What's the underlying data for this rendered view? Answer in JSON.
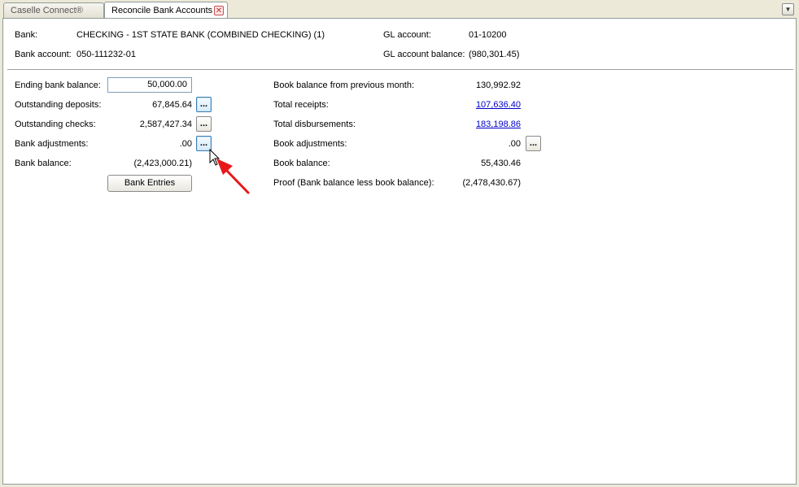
{
  "tabs": [
    {
      "label": "Caselle Connect®"
    },
    {
      "label": "Reconcile Bank Accounts",
      "close": "✕"
    }
  ],
  "tab_menu_icon": "▼",
  "header": {
    "bank_label": "Bank:",
    "bank_value": "CHECKING - 1ST STATE BANK (COMBINED CHECKING) (1)",
    "gl_account_label": "GL account:",
    "gl_account_value": "01-10200",
    "bank_account_label": "Bank account:",
    "bank_account_value": "050-111232-01",
    "gl_balance_label": "GL account balance:",
    "gl_balance_value": "(980,301.45)"
  },
  "left": {
    "ending_bank_balance_label": "Ending bank balance:",
    "ending_bank_balance_value": "50,000.00",
    "outstanding_deposits_label": "Outstanding deposits:",
    "outstanding_deposits_value": "67,845.64",
    "outstanding_checks_label": "Outstanding checks:",
    "outstanding_checks_value": "2,587,427.34",
    "bank_adjustments_label": "Bank adjustments:",
    "bank_adjustments_value": ".00",
    "bank_balance_label": "Bank balance:",
    "bank_balance_value": "(2,423,000.21)",
    "bank_entries_button": "Bank Entries",
    "ellipsis": "..."
  },
  "right": {
    "book_prev_label": "Book balance from previous month:",
    "book_prev_value": "130,992.92",
    "total_receipts_label": "Total receipts:",
    "total_receipts_value": "107,636.40",
    "total_disbursements_label": "Total disbursements:",
    "total_disbursements_value": "183,198.86",
    "book_adjustments_label": "Book adjustments:",
    "book_adjustments_value": ".00",
    "book_balance_label": "Book balance:",
    "book_balance_value": "55,430.46",
    "proof_label": "Proof (Bank balance less book balance):",
    "proof_value": "(2,478,430.67)",
    "ellipsis": "..."
  },
  "colors": {
    "annotation_arrow": "#e81818",
    "link": "#0000cc",
    "window_bg": "#ece9d8"
  }
}
